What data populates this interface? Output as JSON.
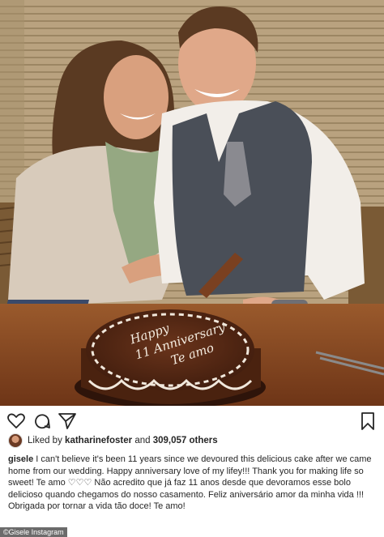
{
  "post": {
    "liked_prefix": "Liked by",
    "liked_user": "katharinefoster",
    "liked_conj": "and",
    "likes_count": "309,057 others",
    "caption_user": "gisele",
    "caption_text": "I can't believe it's been 11 years since we devoured this delicious cake after we came home from our wedding. Happy anniversary love of my lifey!!! Thank you for making life so sweet! Te amo ♡♡♡ Não acredito que já faz 11 anos desde que devoramos esse bolo delicioso quando chegamos do nosso casamento. Feliz aniversário amor da minha vida !!! Obrigada por tornar a vida tão doce! Te amo!"
  },
  "photo": {
    "cake_text": [
      "Happy",
      "11 Anniversary",
      "Te amo"
    ]
  },
  "credit": "©Gisele Instagram",
  "icons": {
    "like": "heart-icon",
    "comment": "comment-icon",
    "share": "share-icon",
    "save": "bookmark-icon"
  },
  "colors": {
    "text": "#262626",
    "wall": "#b7a07e",
    "table": "#8a4a22",
    "cake": "#5a2a16"
  }
}
